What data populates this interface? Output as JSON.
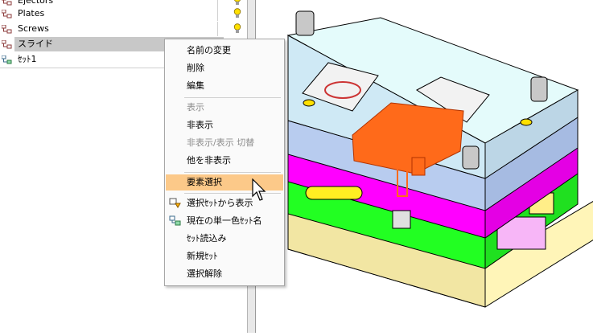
{
  "tree": {
    "rows": [
      {
        "label": "Ejectors"
      },
      {
        "label": "Plates"
      },
      {
        "label": "Screws"
      },
      {
        "label": "スライド"
      },
      {
        "label": "ｾｯﾄ1"
      }
    ]
  },
  "context_menu": {
    "items": [
      {
        "label": "名前の変更",
        "enabled": true
      },
      {
        "label": "削除",
        "enabled": true
      },
      {
        "label": "編集",
        "enabled": true
      },
      {
        "label": "表示",
        "enabled": false
      },
      {
        "label": "非表示",
        "enabled": true
      },
      {
        "label": "非表示/表示 切替",
        "enabled": false
      },
      {
        "label": "他を非表示",
        "enabled": true
      },
      {
        "label": "要素選択",
        "enabled": true,
        "highlighted": true
      },
      {
        "label": "選択ｾｯﾄから表示",
        "enabled": true,
        "icon": "set-display-icon"
      },
      {
        "label": "現在の単一色ｾｯﾄ名",
        "enabled": true,
        "icon": "color-set-icon"
      },
      {
        "label": "ｾｯﾄ読込み",
        "enabled": true
      },
      {
        "label": "新規ｾｯﾄ",
        "enabled": true
      },
      {
        "label": "選択解除",
        "enabled": true
      }
    ]
  },
  "colors": {
    "menu_highlight": "#fcc989",
    "plate_top": "#e4fbfb",
    "plate_blue": "#b8ccef",
    "plate_magenta": "#ff00ff",
    "plate_green": "#22ff22",
    "base_plate": "#fff5b8",
    "slide_part": "#ff6a1a"
  },
  "icons": {
    "tree_item": "tree-node-icon",
    "visibility": "light-bulb-icon",
    "set": "set-node-icon",
    "pointer": "mouse-cursor-icon"
  }
}
